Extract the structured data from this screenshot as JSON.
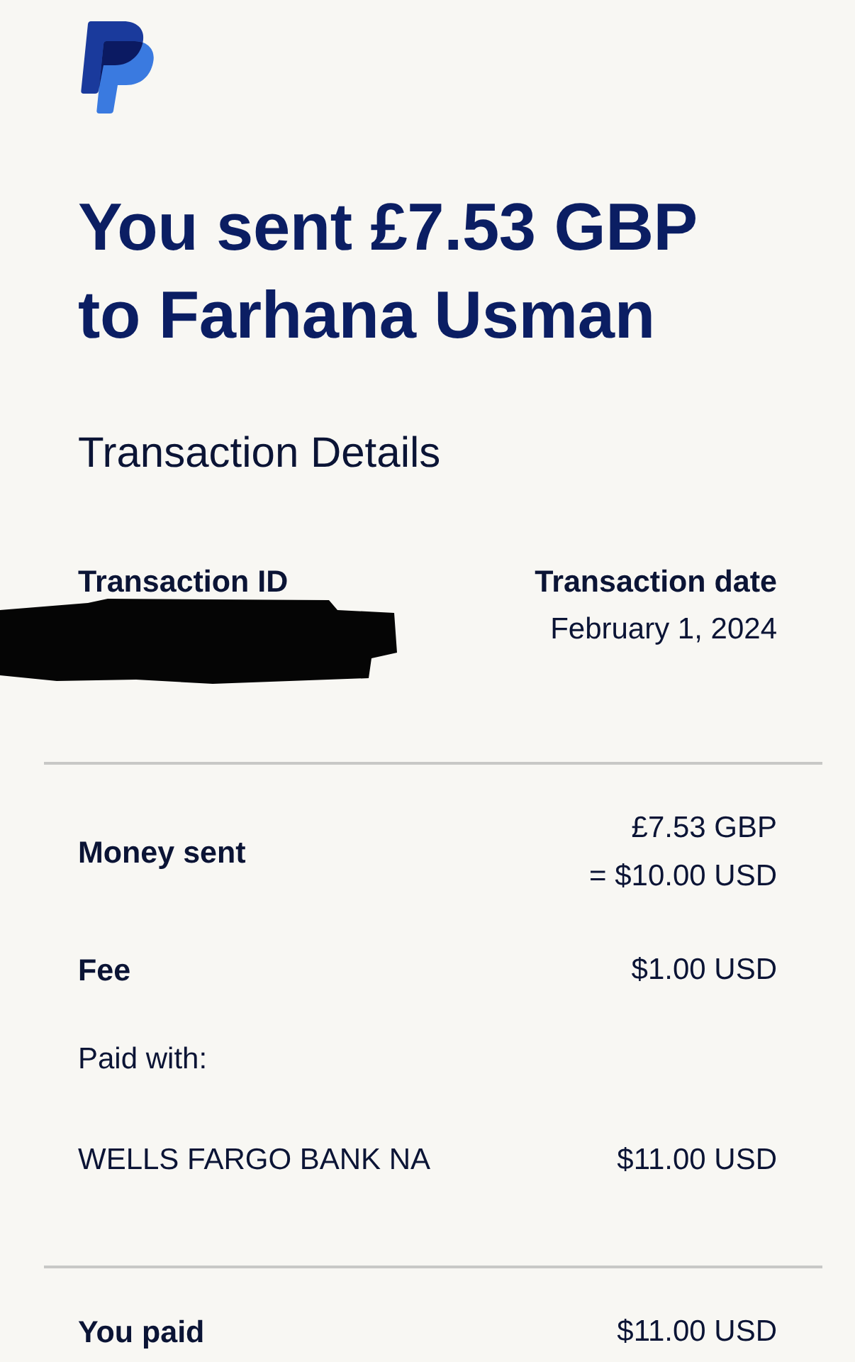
{
  "header": {
    "title": "You sent £7.53 GBP to Farhana Usman"
  },
  "section_title": "Transaction Details",
  "summary": [
    {
      "label": "Transaction ID",
      "redacted": true
    },
    {
      "label": "Transaction date",
      "value": "February 1, 2024"
    }
  ],
  "lines": [
    {
      "kind": "charge",
      "label": "Money sent",
      "values": [
        "£7.53 GBP",
        "= $10.00 USD"
      ]
    },
    {
      "kind": "charge",
      "label": "Fee",
      "values": [
        "$1.00 USD"
      ]
    },
    {
      "kind": "heading",
      "label": "Paid with:"
    },
    {
      "kind": "source",
      "label": "WELLS FARGO BANK NA",
      "values": [
        "$11.00 USD"
      ]
    }
  ],
  "total": {
    "label": "You paid",
    "value": "$11.00 USD"
  }
}
